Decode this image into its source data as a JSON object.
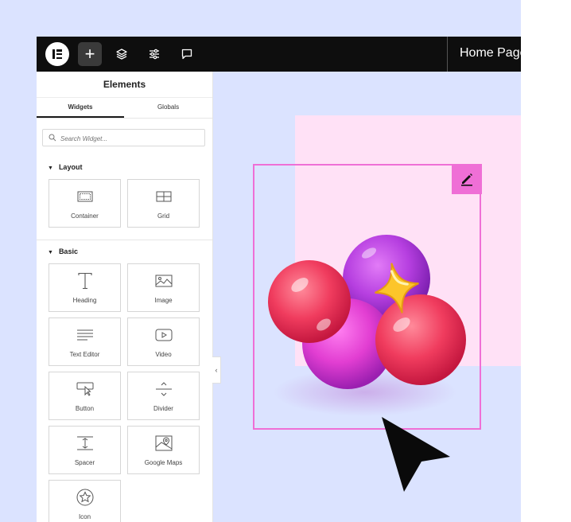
{
  "topbar": {
    "add_label": "+",
    "page_title": "Home Page"
  },
  "panel": {
    "title": "Elements",
    "tabs": [
      {
        "label": "Widgets",
        "active": true
      },
      {
        "label": "Globals",
        "active": false
      }
    ],
    "search_placeholder": "Search Widget...",
    "collapse_label": "‹"
  },
  "sections": {
    "layout": {
      "title": "Layout",
      "items": [
        {
          "label": "Container",
          "icon": "container-icon"
        },
        {
          "label": "Grid",
          "icon": "grid-icon"
        }
      ]
    },
    "basic": {
      "title": "Basic",
      "items": [
        {
          "label": "Heading",
          "icon": "heading-icon"
        },
        {
          "label": "Image",
          "icon": "image-icon"
        },
        {
          "label": "Text Editor",
          "icon": "text-editor-icon"
        },
        {
          "label": "Video",
          "icon": "video-icon"
        },
        {
          "label": "Button",
          "icon": "button-icon"
        },
        {
          "label": "Divider",
          "icon": "divider-icon"
        },
        {
          "label": "Spacer",
          "icon": "spacer-icon"
        },
        {
          "label": "Google Maps",
          "icon": "google-maps-icon"
        },
        {
          "label": "Icon",
          "icon": "icon-widget-icon"
        }
      ]
    }
  },
  "colors": {
    "accent_pink": "#ef6fd6",
    "canvas_bg": "#dbe3ff",
    "topbar_bg": "#0e0e0e"
  }
}
